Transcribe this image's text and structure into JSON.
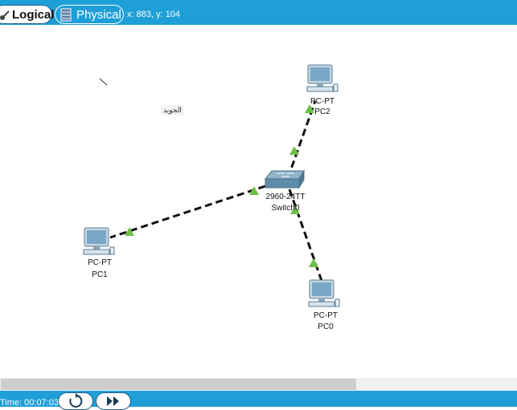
{
  "toolbar": {
    "logical_label": "Logical",
    "physical_label": "Physical",
    "coords": "x: 883, y: 104"
  },
  "canvas": {
    "note": "الجويد",
    "devices": [
      {
        "name": "PC2",
        "type": "PC-PT"
      },
      {
        "name": "PC1",
        "type": "PC-PT"
      },
      {
        "name": "PC0",
        "type": "PC-PT"
      },
      {
        "name": "Switch0",
        "type": "2960-24TT"
      }
    ]
  },
  "statusbar": {
    "time": "Time: 00:07:03"
  },
  "colors": {
    "bar": "#1e9fd8",
    "link_up": "#6cc04a",
    "cable": "#111111"
  }
}
